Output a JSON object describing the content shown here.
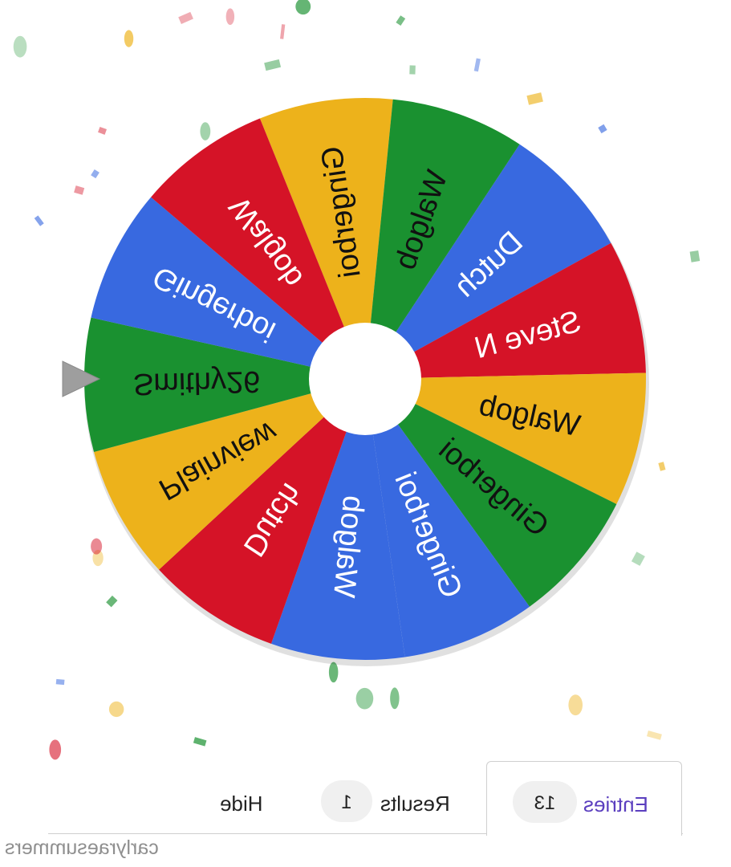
{
  "wheel": {
    "pointer_side": "left",
    "entries": [
      {
        "label": "Gingerboi",
        "color": "#EDB21B"
      },
      {
        "label": "Walgob",
        "color": "#1A9130"
      },
      {
        "label": "Dutch",
        "color": "#3869E0"
      },
      {
        "label": "Steve N",
        "color": "#D51327"
      },
      {
        "label": "Walgob",
        "color": "#EDB21B"
      },
      {
        "label": "Gingerboi",
        "color": "#1A9130"
      },
      {
        "label": "Gingerboi",
        "color": "#3869E0"
      },
      {
        "label": "Walgob",
        "color": "#3869E0"
      },
      {
        "label": "Dutch",
        "color": "#D51327"
      },
      {
        "label": "Plainview",
        "color": "#EDB21B"
      },
      {
        "label": "Smithy26",
        "color": "#1A9130"
      },
      {
        "label": "Gingerboi",
        "color": "#3869E0"
      },
      {
        "label": "Walgob",
        "color": "#D51327"
      }
    ]
  },
  "tabs": {
    "entries_label": "Entries",
    "entries_count": "13",
    "results_label": "Results",
    "results_count": "1",
    "hide_label": "Hide"
  },
  "watermark": "carlyraesummers"
}
